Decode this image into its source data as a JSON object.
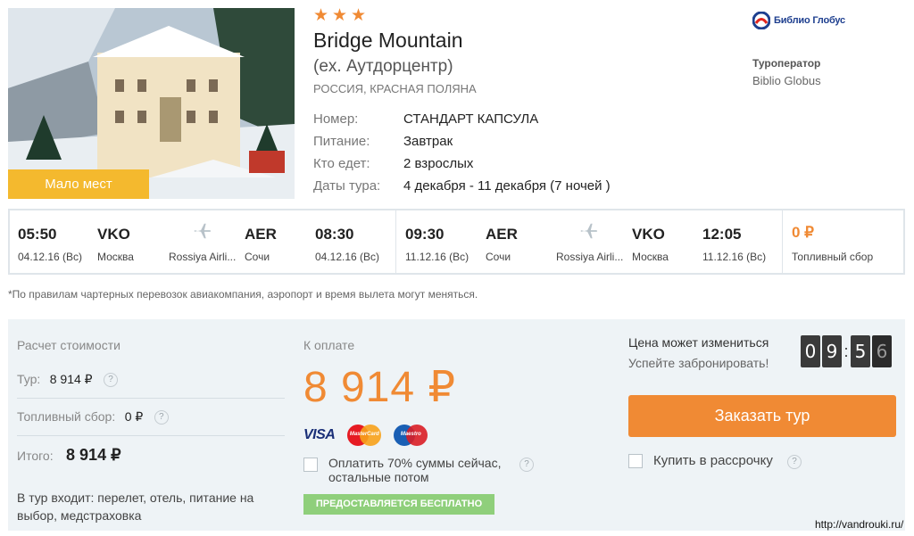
{
  "hotel": {
    "badge": "Мало мест",
    "stars": 3,
    "name": "Bridge Mountain",
    "alt_name": "(ex. Аутдорцентр)",
    "location": "РОССИЯ, КРАСНАЯ ПОЛЯНА",
    "details": [
      {
        "label": "Номер:",
        "value": "СТАНДАРТ КАПСУЛА"
      },
      {
        "label": "Питание:",
        "value": "Завтрак"
      },
      {
        "label": "Кто едет:",
        "value": "2 взрослых"
      },
      {
        "label": "Даты тура:",
        "value": "4 декабря - 11 декабря (7 ночей )"
      }
    ]
  },
  "operator": {
    "logo_text": "Библио Глобус",
    "label": "Туроператор",
    "name": "Biblio Globus"
  },
  "flights": {
    "outbound": {
      "dep_time": "05:50",
      "dep_date": "04.12.16 (Вс)",
      "from_code": "VKO",
      "from_city": "Москва",
      "airline": "Rossiya Airli...",
      "to_code": "AER",
      "to_city": "Сочи",
      "arr_time": "08:30",
      "arr_date": "04.12.16 (Вс)"
    },
    "inbound": {
      "dep_time": "09:30",
      "dep_date": "11.12.16 (Вс)",
      "from_code": "AER",
      "from_city": "Сочи",
      "airline": "Rossiya Airli...",
      "to_code": "VKO",
      "to_city": "Москва",
      "arr_time": "12:05",
      "arr_date": "11.12.16 (Вс)"
    },
    "fuel_value": "0 ₽",
    "fuel_label": "Топливный сбор"
  },
  "note": "*По правилам чартерных перевозок авиакомпания, аэропорт и время вылета могут меняться.",
  "calc": {
    "title": "Расчет стоимости",
    "tour_label": "Тур:",
    "tour_value": "8 914 ₽",
    "fuel_label": "Топливный сбор:",
    "fuel_value": "0 ₽",
    "total_label": "Итого:",
    "total_value": "8 914 ₽",
    "includes": "В тур входит: перелет, отель, питание на выбор, медстраховка",
    "help": "?"
  },
  "payment": {
    "title": "К оплате",
    "amount": "8 914 ₽",
    "card_visa": "VISA",
    "card_mastercard": "MasterCard",
    "card_maestro": "Maestro",
    "partial_line1": "Оплатить 70% суммы сейчас,",
    "partial_line2": "остальные потом",
    "free_label": "ПРЕДОСТАВЛЯЕТСЯ БЕСПЛАТНО"
  },
  "booking": {
    "warn": "Цена может измениться",
    "hint": "Успейте забронировать!",
    "timer": [
      "0",
      "9",
      "5",
      "6"
    ],
    "order_label": "Заказать тур",
    "installment_label": "Купить в рассрочку"
  },
  "watermark": "http://vandrouki.ru/",
  "colors": {
    "accent": "#f08a34",
    "badge": "#f4b92e",
    "panel_bg": "#eef3f6",
    "free_green": "#8fcf7b"
  }
}
